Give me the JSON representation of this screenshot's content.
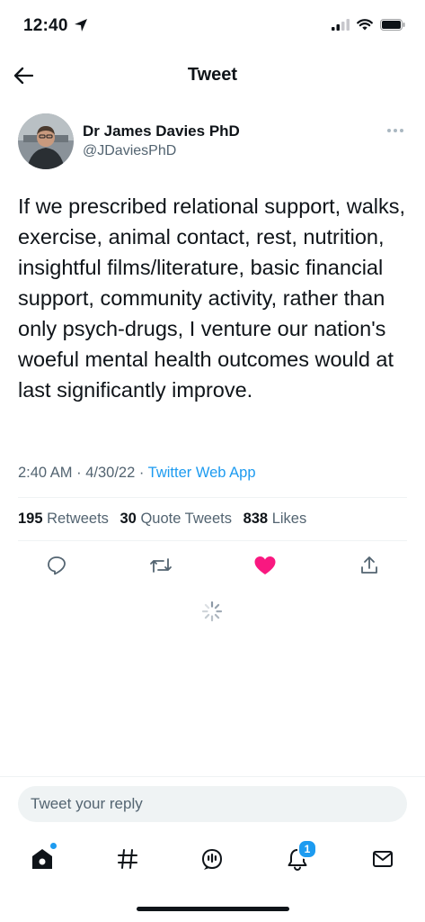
{
  "status_bar": {
    "time": "12:40"
  },
  "header": {
    "title": "Tweet",
    "back_icon": "back-arrow-icon"
  },
  "tweet": {
    "author_name": "Dr James Davies PhD",
    "author_handle": "@JDaviesPhD",
    "text": "If we prescribed relational support, walks, exercise, animal contact, rest, nutrition, insightful films/literature, basic financial support, community activity, rather than only psych-drugs, I venture our nation's woeful mental health outcomes would at last significantly improve.",
    "time": "2:40 AM",
    "date": "4/30/22",
    "source": "Twitter Web App",
    "retweets": "195",
    "retweets_label": "Retweets",
    "quote_tweets": "30",
    "quote_tweets_label": "Quote Tweets",
    "likes": "838",
    "likes_label": "Likes"
  },
  "colors": {
    "accent": "#1d9bf0",
    "like": "#f91880",
    "text": "#0f1419",
    "muted": "#536471"
  },
  "reply": {
    "placeholder": "Tweet your reply"
  },
  "tabs": [
    {
      "name": "home",
      "icon": "home-icon"
    },
    {
      "name": "explore",
      "icon": "hashtag-icon"
    },
    {
      "name": "spaces",
      "icon": "spaces-icon"
    },
    {
      "name": "notifications",
      "icon": "bell-icon",
      "badge": "1"
    },
    {
      "name": "messages",
      "icon": "mail-icon"
    }
  ]
}
